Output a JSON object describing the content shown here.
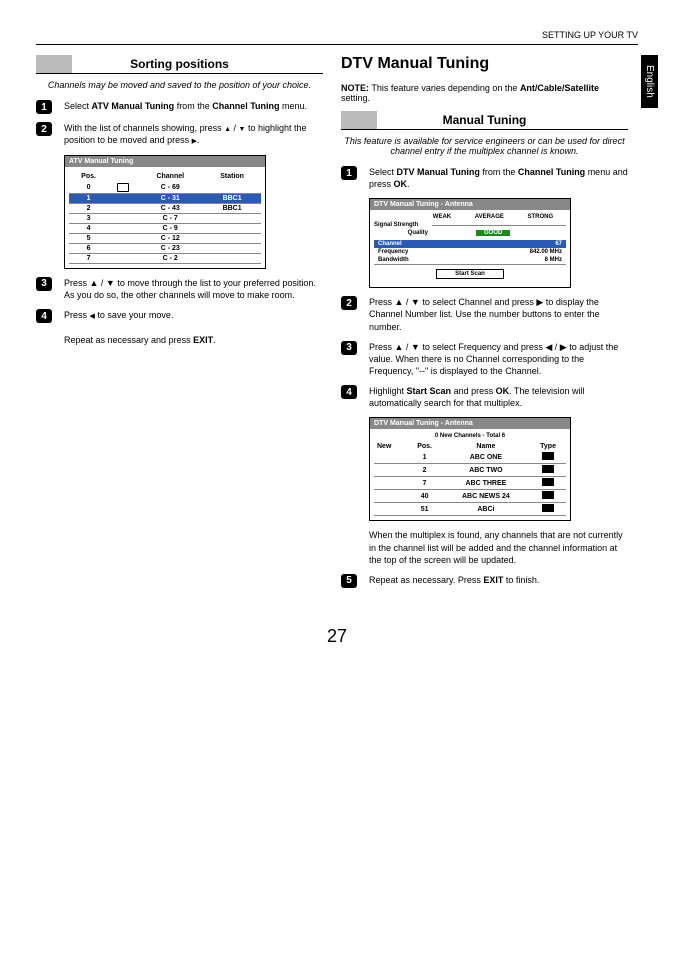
{
  "header": {
    "section": "SETTING UP YOUR TV"
  },
  "lang_tab": "English",
  "page_number": "27",
  "left": {
    "sorting_heading": "Sorting positions",
    "sorting_intro": "Channels may be moved and saved to the position of your choice.",
    "steps": {
      "s1_a": "Select ",
      "s1_b": "ATV Manual Tuning",
      "s1_c": " from the ",
      "s1_d": "Channel Tuning",
      "s1_e": " menu.",
      "s2_a": "With the list of channels showing, press ",
      "s2_b": " / ",
      "s2_c": " to highlight the position to be moved and press ",
      "s2_d": ".",
      "s3": "Press ▲ / ▼ to move through the list to your preferred position. As you do so, the other channels will move to make room.",
      "s4_a": "Press ",
      "s4_b": " to save your move.",
      "s4_repeat_a": "Repeat as necessary and press ",
      "s4_repeat_b": "EXIT",
      "s4_repeat_c": "."
    },
    "atv_table": {
      "title": "ATV Manual Tuning",
      "cols": [
        "Pos.",
        "",
        "Channel",
        "Station"
      ],
      "rows": [
        [
          "0",
          "key",
          "C - 69",
          ""
        ],
        [
          "1",
          "",
          "C - 31",
          "BBC1"
        ],
        [
          "2",
          "",
          "C - 43",
          "BBC1"
        ],
        [
          "3",
          "",
          "C - 7",
          ""
        ],
        [
          "4",
          "",
          "C - 9",
          ""
        ],
        [
          "5",
          "",
          "C - 12",
          ""
        ],
        [
          "6",
          "",
          "C - 23",
          ""
        ],
        [
          "7",
          "",
          "C - 2",
          ""
        ]
      ],
      "selected_index": 1
    }
  },
  "right": {
    "main_heading": "DTV Manual Tuning",
    "note_a": "NOTE:",
    "note_b": " This feature varies depending on the ",
    "note_c": "Ant/Cable/Satellite",
    "note_d": " setting.",
    "manual_heading": "Manual Tuning",
    "manual_intro": "This feature is available for service engineers or can be used for direct channel entry if the multiplex channel is known.",
    "steps": {
      "s1_a": "Select ",
      "s1_b": "DTV Manual Tuning",
      "s1_c": " from the ",
      "s1_d": "Channel Tuning",
      "s1_e": " menu and press ",
      "s1_f": "OK",
      "s1_g": ".",
      "s2": "Press ▲ / ▼ to select Channel and press ▶ to display the Channel Number list. Use the number buttons to enter the number.",
      "s3": "Press ▲ / ▼ to select Frequency and press ◀ / ▶ to adjust the value. When there is no Channel corresponding to the Frequency, \"--\" is displayed to the Channel.",
      "s4_a": "Highlight ",
      "s4_b": "Start Scan",
      "s4_c": " and press ",
      "s4_d": "OK",
      "s4_e": ". The television will automatically search for that multiplex.",
      "s5_a": "Repeat as necessary. Press ",
      "s5_b": "EXIT",
      "s5_c": " to finish."
    },
    "dtv_box1": {
      "title": "DTV Manual Tuning - Antenna",
      "strength_labels": [
        "WEAK",
        "AVERAGE",
        "STRONG"
      ],
      "signal_label": "Signal Strength",
      "quality_label": "Quality",
      "quality_value": "GOOD",
      "channel_label": "Channel",
      "channel_value": "67",
      "freq_label": "Frequency",
      "freq_value": "842.00 MHz",
      "bw_label": "Bandwidth",
      "bw_value": "8 MHz",
      "scan_btn": "Start Scan"
    },
    "followup": "When the multiplex is found, any channels that are not currently in the channel list will be added and the channel information at the top of the screen will be updated.",
    "dtv_box2": {
      "title": "DTV Manual Tuning - Antenna",
      "summary": "0 New Channels - Total 6",
      "cols": [
        "New",
        "Pos.",
        "Name",
        "Type"
      ],
      "rows": [
        [
          "",
          "1",
          "ABC ONE",
          "tv"
        ],
        [
          "",
          "2",
          "ABC TWO",
          "tv"
        ],
        [
          "",
          "7",
          "ABC THREE",
          "tv"
        ],
        [
          "",
          "40",
          "ABC NEWS 24",
          "tv"
        ],
        [
          "",
          "51",
          "ABCi",
          "tv"
        ]
      ]
    }
  }
}
